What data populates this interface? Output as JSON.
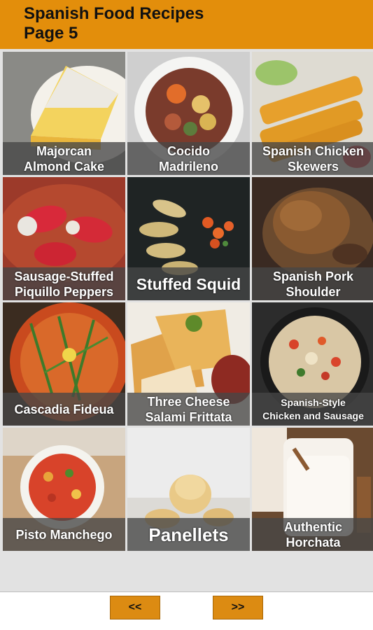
{
  "header": {
    "title_line1": "Spanish Food Recipes",
    "title_line2": "Page 5"
  },
  "colors": {
    "header_bg": "#e38e0b",
    "button_bg": "#dc8b12",
    "grid_bg": "#e2e2e2",
    "label_overlay": "#464646"
  },
  "recipes": [
    {
      "label": "Majorcan\nAlmond Cake"
    },
    {
      "label": "Cocido\nMadrileno"
    },
    {
      "label": "Spanish Chicken\nSkewers"
    },
    {
      "label": "Sausage-Stuffed\nPiquillo Peppers"
    },
    {
      "label": "Stuffed Squid"
    },
    {
      "label": "Spanish Pork\nShoulder"
    },
    {
      "label": "Cascadia Fideua"
    },
    {
      "label": "Three Cheese\nSalami Frittata"
    },
    {
      "label": "Spanish-Style\nChicken and Sausage"
    },
    {
      "label": "Pisto Manchego"
    },
    {
      "label": "Panellets"
    },
    {
      "label": "Authentic\nHorchata"
    }
  ],
  "nav": {
    "prev_label": "<<",
    "next_label": ">>"
  }
}
